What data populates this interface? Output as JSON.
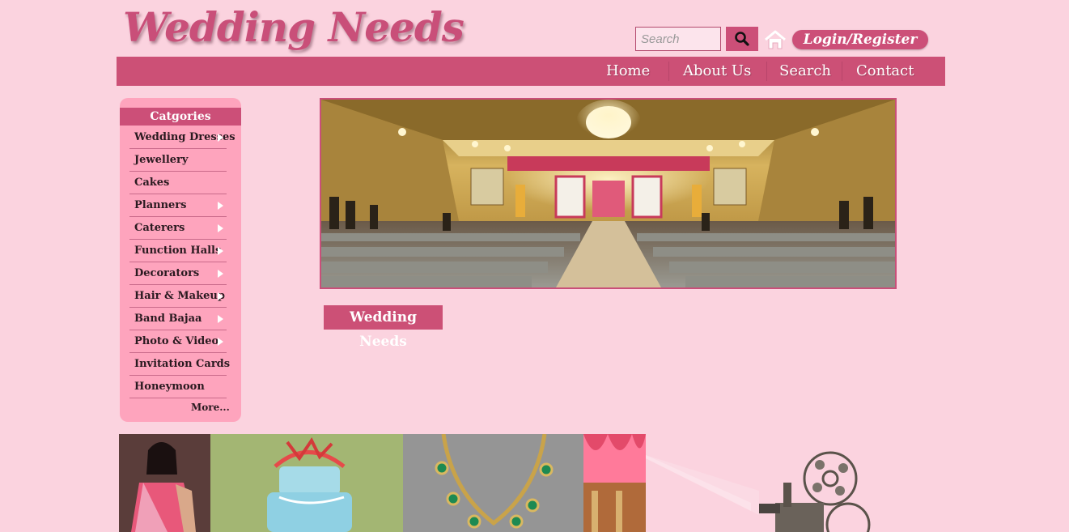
{
  "brand": {
    "logo_text": "Wedding Needs"
  },
  "header": {
    "search_placeholder": "Search",
    "login_label": "Login/Register"
  },
  "nav": {
    "items": [
      {
        "label": "Home"
      },
      {
        "label": "About Us"
      },
      {
        "label": "Search"
      },
      {
        "label": "Contact"
      }
    ]
  },
  "sidebar": {
    "title": "Catgories",
    "items": [
      {
        "label": "Wedding Dresses",
        "submenu": true
      },
      {
        "label": "Jewellery",
        "submenu": false
      },
      {
        "label": "Cakes",
        "submenu": false
      },
      {
        "label": "Planners",
        "submenu": true
      },
      {
        "label": "Caterers",
        "submenu": true
      },
      {
        "label": "Function Halls",
        "submenu": true
      },
      {
        "label": "Decorators",
        "submenu": true
      },
      {
        "label": "Hair & Makeup",
        "submenu": true
      },
      {
        "label": "Band Bajaa",
        "submenu": true
      },
      {
        "label": "Photo & Video",
        "submenu": true
      },
      {
        "label": "Invitation Cards",
        "submenu": false
      },
      {
        "label": "Honeymoon",
        "submenu": false
      }
    ],
    "more_label": "More..."
  },
  "main": {
    "section_title": "Wedding Needs"
  },
  "colors": {
    "page_bg": "#fbd3df",
    "accent": "#cc5076",
    "sidebar_bg": "#fea4bd"
  },
  "icons": {
    "search": "search-icon",
    "home": "home-icon",
    "submenu": "chevron-right-icon"
  }
}
